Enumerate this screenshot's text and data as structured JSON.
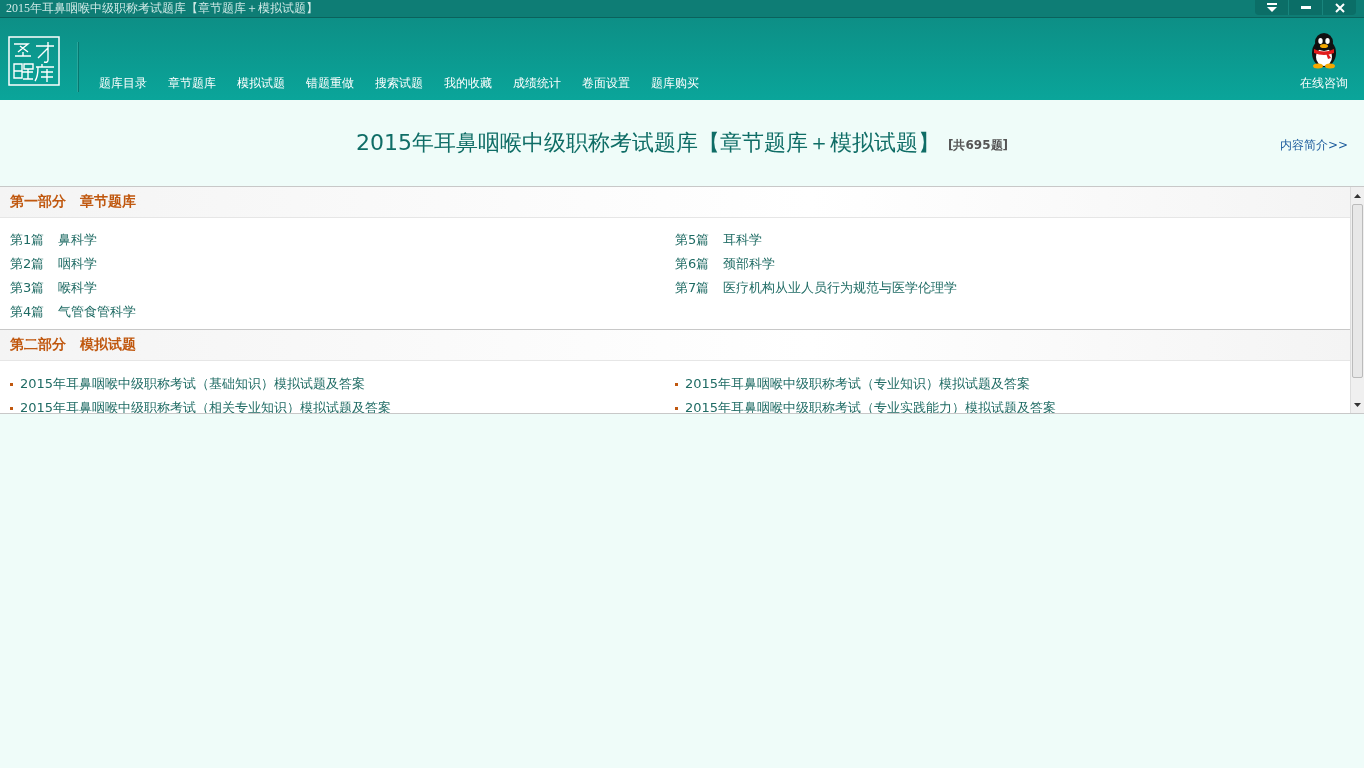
{
  "window": {
    "title": "2015年耳鼻咽喉中级职称考试题库【章节题库＋模拟试题】"
  },
  "nav": {
    "items": [
      "题库目录",
      "章节题库",
      "模拟试题",
      "错题重做",
      "搜索试题",
      "我的收藏",
      "成绩统计",
      "卷面设置",
      "题库购买"
    ],
    "consult": "在线咨询"
  },
  "heading": {
    "title": "2015年耳鼻咽喉中级职称考试题库【章节题库＋模拟试题】",
    "count": "[共695题]",
    "link": "内容简介>>"
  },
  "sections": [
    {
      "part": "第一部分",
      "name": "章节题库",
      "kind": "chapters",
      "columns": [
        [
          {
            "number": "第1篇",
            "name": "鼻科学"
          },
          {
            "number": "第2篇",
            "name": "咽科学"
          },
          {
            "number": "第3篇",
            "name": "喉科学"
          },
          {
            "number": "第4篇",
            "name": "气管食管科学"
          }
        ],
        [
          {
            "number": "第5篇",
            "name": "耳科学"
          },
          {
            "number": "第6篇",
            "name": "颈部科学"
          },
          {
            "number": "第7篇",
            "name": "医疗机构从业人员行为规范与医学伦理学"
          }
        ]
      ]
    },
    {
      "part": "第二部分",
      "name": "模拟试题",
      "kind": "papers",
      "columns": [
        [
          {
            "name": "2015年耳鼻咽喉中级职称考试（基础知识）模拟试题及答案"
          },
          {
            "name": "2015年耳鼻咽喉中级职称考试（相关专业知识）模拟试题及答案"
          }
        ],
        [
          {
            "name": "2015年耳鼻咽喉中级职称考试（专业知识）模拟试题及答案"
          },
          {
            "name": "2015年耳鼻咽喉中级职称考试（专业实践能力）模拟试题及答案"
          }
        ]
      ]
    }
  ]
}
